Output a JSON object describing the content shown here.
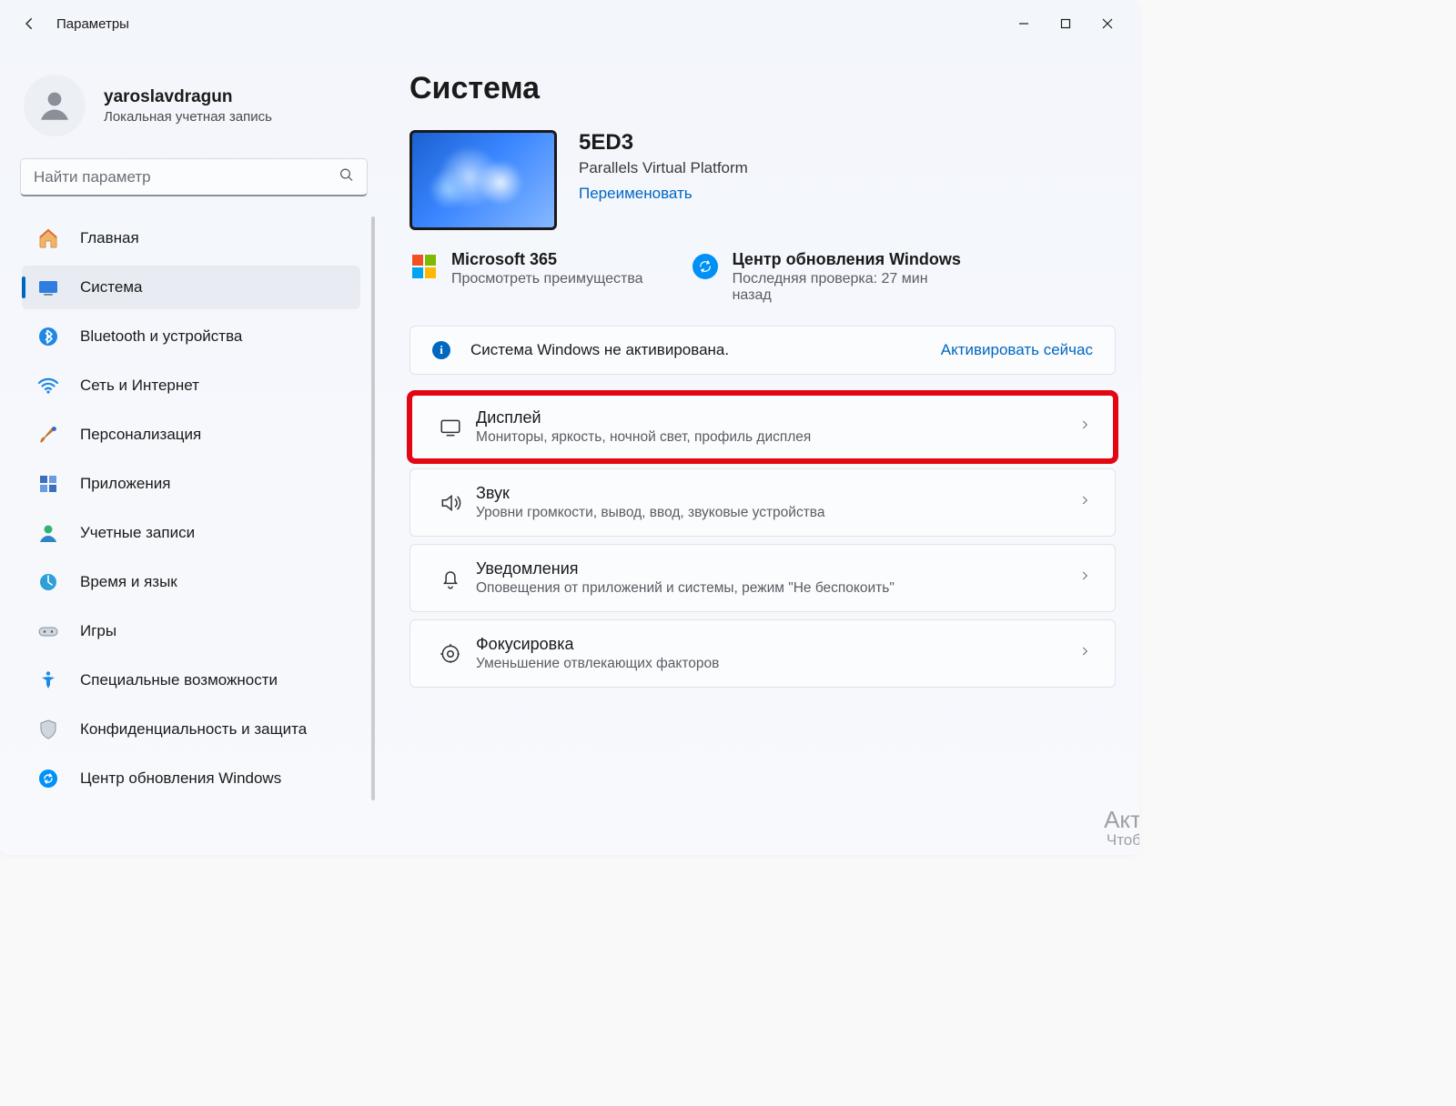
{
  "window": {
    "title": "Параметры"
  },
  "user": {
    "name": "yaroslavdragun",
    "subtitle": "Локальная учетная запись"
  },
  "search": {
    "placeholder": "Найти параметр"
  },
  "nav": [
    {
      "key": "home",
      "label": "Главная",
      "active": false
    },
    {
      "key": "system",
      "label": "Система",
      "active": true
    },
    {
      "key": "bluetooth",
      "label": "Bluetooth и устройства",
      "active": false
    },
    {
      "key": "network",
      "label": "Сеть и Интернет",
      "active": false
    },
    {
      "key": "personalization",
      "label": "Персонализация",
      "active": false
    },
    {
      "key": "apps",
      "label": "Приложения",
      "active": false
    },
    {
      "key": "accounts",
      "label": "Учетные записи",
      "active": false
    },
    {
      "key": "time",
      "label": "Время и язык",
      "active": false
    },
    {
      "key": "gaming",
      "label": "Игры",
      "active": false
    },
    {
      "key": "accessibility",
      "label": "Специальные возможности",
      "active": false
    },
    {
      "key": "privacy",
      "label": "Конфиденциальность и защита",
      "active": false
    },
    {
      "key": "update",
      "label": "Центр обновления Windows",
      "active": false
    }
  ],
  "page": {
    "title": "Система",
    "device": {
      "name": "5ED3",
      "platform": "Parallels Virtual Platform",
      "rename_link": "Переименовать"
    },
    "recs": {
      "m365": {
        "title": "Microsoft 365",
        "subtitle": "Просмотреть преимущества"
      },
      "update": {
        "title": "Центр обновления Windows",
        "subtitle": "Последняя проверка: 27 мин назад"
      }
    },
    "activation_banner": {
      "text": "Система Windows не активирована.",
      "link": "Активировать сейчас"
    },
    "cards": [
      {
        "key": "display",
        "title": "Дисплей",
        "subtitle": "Мониторы, яркость, ночной свет, профиль дисплея",
        "highlighted": true
      },
      {
        "key": "sound",
        "title": "Звук",
        "subtitle": "Уровни громкости, вывод, ввод, звуковые устройства",
        "highlighted": false
      },
      {
        "key": "notifications",
        "title": "Уведомления",
        "subtitle": "Оповещения от приложений и системы, режим \"Не беспокоить\"",
        "highlighted": false
      },
      {
        "key": "focus",
        "title": "Фокусировка",
        "subtitle": "Уменьшение отвлекающих факторов",
        "highlighted": false
      }
    ]
  },
  "watermark": {
    "line1": "Акт",
    "line2": "Чтоб"
  }
}
